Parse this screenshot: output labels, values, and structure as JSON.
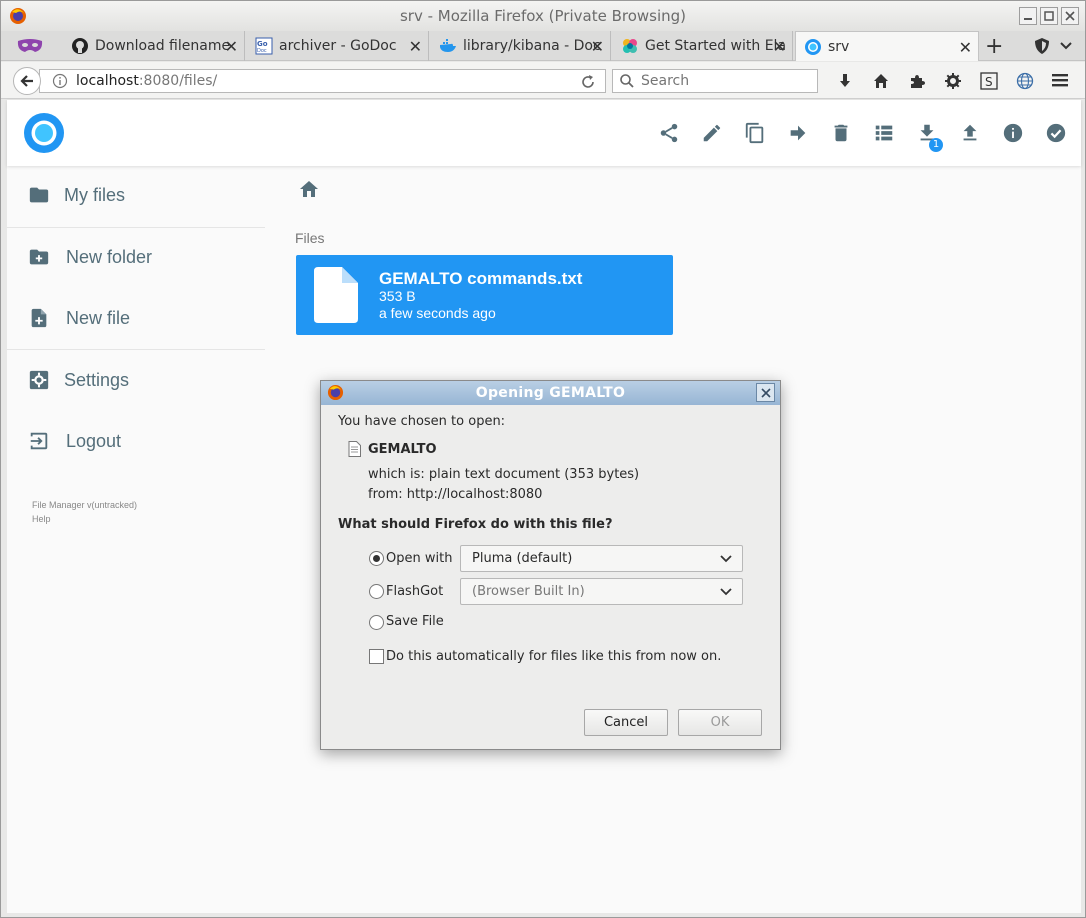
{
  "window": {
    "title": "srv - Mozilla Firefox (Private Browsing)"
  },
  "tabs": [
    {
      "label": "Download filename",
      "icon": "github-icon"
    },
    {
      "label": "archiver - GoDoc",
      "icon": "godoc-icon"
    },
    {
      "label": "library/kibana - Doc",
      "icon": "docker-icon"
    },
    {
      "label": "Get Started with Ela",
      "icon": "elastic-icon"
    },
    {
      "label": "srv",
      "icon": "srv-icon",
      "active": true
    }
  ],
  "navbar": {
    "url_host": "localhost",
    "url_rest": ":8080/files/",
    "search_placeholder": "Search"
  },
  "sidebar": {
    "items": [
      {
        "label": "My files"
      },
      {
        "label": "New folder"
      },
      {
        "label": "New file"
      },
      {
        "label": "Settings"
      },
      {
        "label": "Logout"
      }
    ],
    "footer_version": "File Manager v(untracked)",
    "footer_help": "Help"
  },
  "header": {
    "download_count": "1"
  },
  "main": {
    "section_label": "Files",
    "file": {
      "name": "GEMALTO commands.txt",
      "size": "353 B",
      "modified": "a few seconds ago"
    }
  },
  "dialog": {
    "title": "Opening GEMALTO",
    "intro": "You have chosen to open:",
    "filename": "GEMALTO",
    "which_is": "which is: plain text document (353 bytes)",
    "from": "from: http://localhost:8080",
    "question": "What should Firefox do with this file?",
    "open_with_label": "Open with",
    "open_with_value": "Pluma (default)",
    "flashgot_label": "FlashGot",
    "flashgot_value": "(Browser Built In)",
    "save_label": "Save File",
    "auto_label": "Do this automatically for files like this from now on.",
    "cancel": "Cancel",
    "ok": "OK"
  },
  "colors": {
    "accent": "#2196f3",
    "sidebar_text": "#546e7a",
    "icon": "#546e7a"
  }
}
